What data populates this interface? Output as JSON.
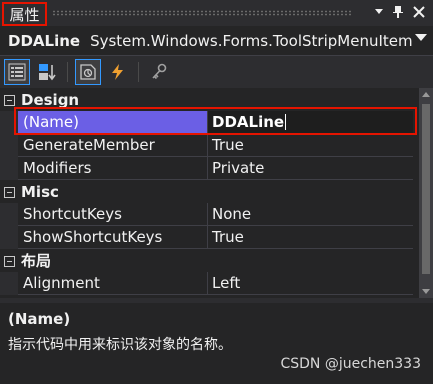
{
  "window": {
    "title": "属性"
  },
  "object": {
    "name": "DDALine",
    "type": "System.Windows.Forms.ToolStripMenuItem"
  },
  "toolbar": {
    "icons": [
      "categorized-icon",
      "alphabetical-icon",
      "properties-icon",
      "events-icon",
      "property-pages-icon"
    ]
  },
  "grid": {
    "categories": [
      {
        "label": "Design",
        "rows": [
          {
            "name": "(Name)",
            "value": "DDALine",
            "selected": true
          },
          {
            "name": "GenerateMember",
            "value": "True"
          },
          {
            "name": "Modifiers",
            "value": "Private"
          }
        ]
      },
      {
        "label": "Misc",
        "rows": [
          {
            "name": "ShortcutKeys",
            "value": "None"
          },
          {
            "name": "ShowShortcutKeys",
            "value": "True"
          }
        ]
      },
      {
        "label": "布局",
        "rows": [
          {
            "name": "Alignment",
            "value": "Left"
          }
        ]
      }
    ]
  },
  "description": {
    "title": "(Name)",
    "text": "指示代码中用来标识该对象的名称。"
  },
  "watermark": "CSDN @juechen333",
  "colors": {
    "accent": "#3399ff",
    "highlight": "#e51400",
    "selection": "#6b5fe5"
  }
}
